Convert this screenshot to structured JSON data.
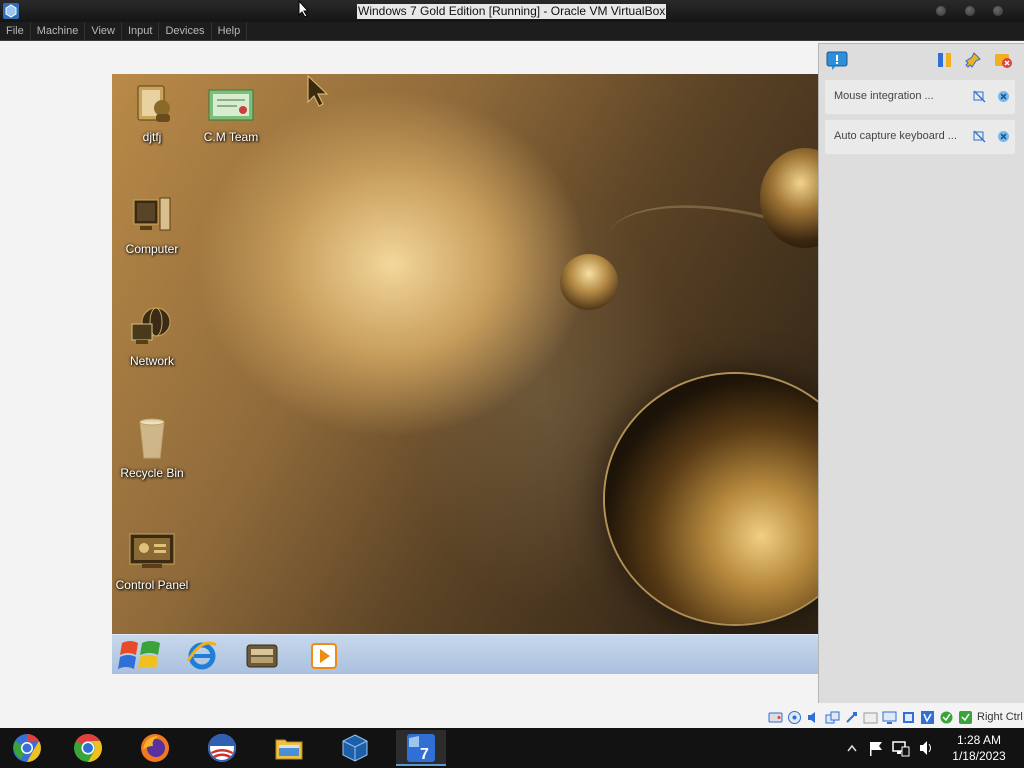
{
  "window": {
    "title": "Windows 7 Gold Edition [Running] - Oracle VM VirtualBox",
    "app_icon": "virtualbox-icon"
  },
  "menu": {
    "items": [
      "File",
      "Machine",
      "View",
      "Input",
      "Devices",
      "Help"
    ]
  },
  "guest": {
    "desktop_icons": [
      {
        "label": "djtfj",
        "icon": "user-folder-icon"
      },
      {
        "label": "C.M Team",
        "icon": "certificate-icon"
      },
      {
        "label": "Computer",
        "icon": "computer-icon"
      },
      {
        "label": "Network",
        "icon": "network-icon"
      },
      {
        "label": "Recycle Bin",
        "icon": "recycle-bin-icon"
      },
      {
        "label": "Control Panel",
        "icon": "control-panel-icon"
      }
    ],
    "taskbar": {
      "items": [
        "start-orb-icon",
        "internet-explorer-icon",
        "file-explorer-icon",
        "media-player-icon"
      ]
    }
  },
  "notifications": {
    "header_icons": [
      "notification-center-icon",
      "sort-icon",
      "pin-icon",
      "clear-all-icon"
    ],
    "items": [
      {
        "text": "Mouse integration ..."
      },
      {
        "text": "Auto capture keyboard ..."
      }
    ]
  },
  "vm_status": {
    "icons": [
      "hard-disk-icon",
      "optical-drive-icon",
      "audio-icon",
      "network-adapter-icon",
      "usb-icon",
      "shared-folders-icon",
      "display-icon",
      "recording-icon",
      "cpu-icon",
      "mouse-integration-icon",
      "keyboard-capture-icon"
    ],
    "host_key": "Right Ctrl"
  },
  "host_taskbar": {
    "apps": [
      "chromium-icon",
      "chrome-icon",
      "firefox-icon",
      "obama-logo-icon",
      "file-manager-icon",
      "virtualbox-icon",
      "windows-7-icon"
    ],
    "tray_icons": [
      "chevron-up-icon",
      "flag-icon",
      "network-icon",
      "volume-icon"
    ],
    "time": "1:28 AM",
    "date": "1/18/2023"
  },
  "colors": {
    "host_chrome": "#1d1d1d",
    "guest_taskbar": "#a9c0dd",
    "notification_panel": "#d6d6d6"
  }
}
